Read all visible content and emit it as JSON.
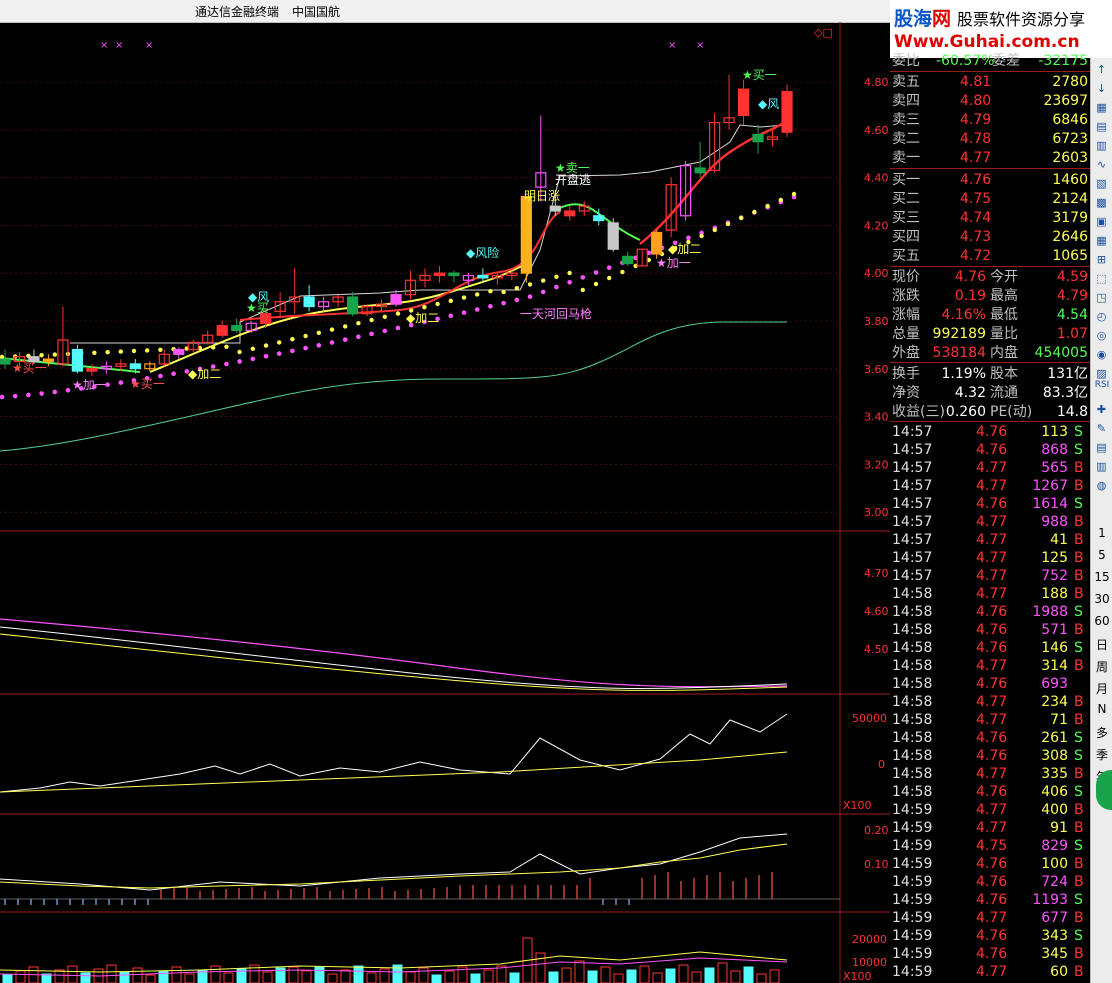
{
  "window": {
    "app_title": "通达信金融终端",
    "stock_name": "中国国航"
  },
  "branding": {
    "logo_name_a": "股海",
    "logo_name_b": "网",
    "logo_slogan": "股票软件资源分享",
    "logo_url": "Www.Guhai.com.cn"
  },
  "price_axis": [
    "4.80",
    "4.60",
    "4.40",
    "4.20",
    "4.00",
    "3.80",
    "3.60",
    "3.40",
    "3.20",
    "3.00"
  ],
  "ma_axis": [
    "4.70",
    "4.60",
    "4.50"
  ],
  "vol_axis": [
    "50000",
    "0"
  ],
  "vol_unit": "X100",
  "osc_axis": [
    "0.20",
    "0.10"
  ],
  "amount_axis": [
    "20000",
    "10000"
  ],
  "amount_unit": "X100",
  "chart_labels": {
    "risk1": "◆风险",
    "risk2": "◆风",
    "buy1": "★买一",
    "buy1b": "★买一",
    "add1a": "★加一",
    "add1b": "★加一",
    "add2a": "◆加二",
    "add2b": "◆加二",
    "add2c": "◆加二",
    "sell1": "★卖一",
    "open_escape": "开盘逃",
    "tomorrow_up": "明日涨",
    "bull": "一天河回马枪",
    "buy_top": "★买一",
    "buy_mid": "★买",
    "risk_mid": "◆风"
  },
  "chart_data": {
    "type": "candlestick",
    "title": "",
    "y_range": [
      2.95,
      4.85
    ],
    "candles": [
      {
        "o": 3.64,
        "h": 3.68,
        "l": 3.6,
        "c": 3.62
      },
      {
        "o": 3.63,
        "h": 3.67,
        "l": 3.61,
        "c": 3.65
      },
      {
        "o": 3.65,
        "h": 3.68,
        "l": 3.62,
        "c": 3.63
      },
      {
        "o": 3.63,
        "h": 3.66,
        "l": 3.61,
        "c": 3.64
      },
      {
        "o": 3.62,
        "h": 3.86,
        "l": 3.61,
        "c": 3.72
      },
      {
        "o": 3.68,
        "h": 3.7,
        "l": 3.58,
        "c": 3.59
      },
      {
        "o": 3.59,
        "h": 3.62,
        "l": 3.57,
        "c": 3.6
      },
      {
        "o": 3.6,
        "h": 3.63,
        "l": 3.58,
        "c": 3.61
      },
      {
        "o": 3.61,
        "h": 3.64,
        "l": 3.59,
        "c": 3.62
      },
      {
        "o": 3.62,
        "h": 3.64,
        "l": 3.58,
        "c": 3.6
      },
      {
        "o": 3.6,
        "h": 3.63,
        "l": 3.59,
        "c": 3.62
      },
      {
        "o": 3.62,
        "h": 3.68,
        "l": 3.61,
        "c": 3.66
      },
      {
        "o": 3.66,
        "h": 3.69,
        "l": 3.64,
        "c": 3.68
      },
      {
        "o": 3.68,
        "h": 3.72,
        "l": 3.67,
        "c": 3.71
      },
      {
        "o": 3.71,
        "h": 3.76,
        "l": 3.7,
        "c": 3.74
      },
      {
        "o": 3.74,
        "h": 3.8,
        "l": 3.73,
        "c": 3.78
      },
      {
        "o": 3.78,
        "h": 3.81,
        "l": 3.75,
        "c": 3.76
      },
      {
        "o": 3.76,
        "h": 3.8,
        "l": 3.75,
        "c": 3.79
      },
      {
        "o": 3.79,
        "h": 3.85,
        "l": 3.77,
        "c": 3.83
      },
      {
        "o": 3.84,
        "h": 3.92,
        "l": 3.82,
        "c": 3.88
      },
      {
        "o": 3.88,
        "h": 4.02,
        "l": 3.83,
        "c": 3.9
      },
      {
        "o": 3.9,
        "h": 3.95,
        "l": 3.84,
        "c": 3.86
      },
      {
        "o": 3.86,
        "h": 3.9,
        "l": 3.84,
        "c": 3.88
      },
      {
        "o": 3.88,
        "h": 3.91,
        "l": 3.86,
        "c": 3.9
      },
      {
        "o": 3.9,
        "h": 3.92,
        "l": 3.82,
        "c": 3.83
      },
      {
        "o": 3.83,
        "h": 3.87,
        "l": 3.82,
        "c": 3.86
      },
      {
        "o": 3.86,
        "h": 3.89,
        "l": 3.84,
        "c": 3.87
      },
      {
        "o": 3.87,
        "h": 3.93,
        "l": 3.86,
        "c": 3.91
      },
      {
        "o": 3.91,
        "h": 4.01,
        "l": 3.89,
        "c": 3.97
      },
      {
        "o": 3.97,
        "h": 4.02,
        "l": 3.94,
        "c": 3.99
      },
      {
        "o": 3.99,
        "h": 4.03,
        "l": 3.96,
        "c": 4.0
      },
      {
        "o": 4.0,
        "h": 4.01,
        "l": 3.96,
        "c": 3.99
      },
      {
        "o": 3.97,
        "h": 4.0,
        "l": 3.95,
        "c": 3.99
      },
      {
        "o": 3.99,
        "h": 4.02,
        "l": 3.96,
        "c": 3.98
      },
      {
        "o": 3.98,
        "h": 4.0,
        "l": 3.95,
        "c": 3.99
      },
      {
        "o": 3.99,
        "h": 4.01,
        "l": 3.97,
        "c": 4.0
      },
      {
        "o": 4.0,
        "h": 4.32,
        "l": 3.96,
        "c": 4.32
      },
      {
        "o": 4.36,
        "h": 4.66,
        "l": 4.3,
        "c": 4.42
      },
      {
        "o": 4.28,
        "h": 4.31,
        "l": 4.24,
        "c": 4.26
      },
      {
        "o": 4.24,
        "h": 4.28,
        "l": 4.22,
        "c": 4.26
      },
      {
        "o": 4.26,
        "h": 4.3,
        "l": 4.24,
        "c": 4.28
      },
      {
        "o": 4.24,
        "h": 4.27,
        "l": 4.2,
        "c": 4.22
      },
      {
        "o": 4.21,
        "h": 4.23,
        "l": 4.09,
        "c": 4.1
      },
      {
        "o": 4.07,
        "h": 4.09,
        "l": 4.03,
        "c": 4.04
      },
      {
        "o": 4.03,
        "h": 4.1,
        "l": 4.03,
        "c": 4.1
      },
      {
        "o": 4.08,
        "h": 4.18,
        "l": 4.06,
        "c": 4.17
      },
      {
        "o": 4.18,
        "h": 4.4,
        "l": 4.15,
        "c": 4.37
      },
      {
        "o": 4.24,
        "h": 4.47,
        "l": 4.22,
        "c": 4.45
      },
      {
        "o": 4.44,
        "h": 4.55,
        "l": 4.4,
        "c": 4.42
      },
      {
        "o": 4.43,
        "h": 4.67,
        "l": 4.42,
        "c": 4.63
      },
      {
        "o": 4.63,
        "h": 4.83,
        "l": 4.6,
        "c": 4.65
      },
      {
        "o": 4.66,
        "h": 4.81,
        "l": 4.62,
        "c": 4.77
      },
      {
        "o": 4.58,
        "h": 4.62,
        "l": 4.5,
        "c": 4.55
      },
      {
        "o": 4.56,
        "h": 4.6,
        "l": 4.53,
        "c": 4.57
      },
      {
        "o": 4.59,
        "h": 4.79,
        "l": 4.57,
        "c": 4.76
      }
    ]
  },
  "quote": {
    "top": {
      "label": "委比",
      "value": "-60.57%",
      "label2": "委差",
      "value2": "-32175"
    },
    "asks": [
      {
        "label": "卖五",
        "price": "4.81",
        "vol": "2780"
      },
      {
        "label": "卖四",
        "price": "4.80",
        "vol": "23697"
      },
      {
        "label": "卖三",
        "price": "4.79",
        "vol": "6846"
      },
      {
        "label": "卖二",
        "price": "4.78",
        "vol": "6723"
      },
      {
        "label": "卖一",
        "price": "4.77",
        "vol": "2603"
      }
    ],
    "bids": [
      {
        "label": "买一",
        "price": "4.76",
        "vol": "1460"
      },
      {
        "label": "买二",
        "price": "4.75",
        "vol": "2124"
      },
      {
        "label": "买三",
        "price": "4.74",
        "vol": "3179"
      },
      {
        "label": "买四",
        "price": "4.73",
        "vol": "2646"
      },
      {
        "label": "买五",
        "price": "4.72",
        "vol": "1065"
      }
    ],
    "stats": [
      {
        "l1": "现价",
        "v1": "4.76",
        "l2": "今开",
        "v2": "4.59"
      },
      {
        "l1": "涨跌",
        "v1": "0.19",
        "l2": "最高",
        "v2": "4.79"
      },
      {
        "l1": "涨幅",
        "v1": "4.16%",
        "l2": "最低",
        "v2": "4.54"
      },
      {
        "l1": "总量",
        "v1": "992189",
        "l2": "量比",
        "v2": "1.07"
      },
      {
        "l1": "外盘",
        "v1": "538184",
        "l2": "内盘",
        "v2": "454005"
      }
    ],
    "info": [
      {
        "l1": "换手",
        "v1": "1.19%",
        "l2": "股本",
        "v2": "131亿"
      },
      {
        "l1": "净资",
        "v1": "4.32",
        "l2": "流通",
        "v2": "83.3亿"
      },
      {
        "l1": "收益(三)",
        "v1": "0.260",
        "l2": "PE(动)",
        "v2": "14.8"
      }
    ]
  },
  "ticks": [
    {
      "t": "14:57",
      "p": "4.76",
      "v": "113",
      "s": "S"
    },
    {
      "t": "14:57",
      "p": "4.76",
      "v": "868",
      "s": "S"
    },
    {
      "t": "14:57",
      "p": "4.77",
      "v": "565",
      "s": "B"
    },
    {
      "t": "14:57",
      "p": "4.77",
      "v": "1267",
      "s": "B"
    },
    {
      "t": "14:57",
      "p": "4.76",
      "v": "1614",
      "s": "S"
    },
    {
      "t": "14:57",
      "p": "4.77",
      "v": "988",
      "s": "B"
    },
    {
      "t": "14:57",
      "p": "4.77",
      "v": "41",
      "s": "B"
    },
    {
      "t": "14:57",
      "p": "4.77",
      "v": "125",
      "s": "B"
    },
    {
      "t": "14:57",
      "p": "4.77",
      "v": "752",
      "s": "B"
    },
    {
      "t": "14:58",
      "p": "4.77",
      "v": "188",
      "s": "B"
    },
    {
      "t": "14:58",
      "p": "4.76",
      "v": "1988",
      "s": "S"
    },
    {
      "t": "14:58",
      "p": "4.76",
      "v": "571",
      "s": "B"
    },
    {
      "t": "14:58",
      "p": "4.76",
      "v": "146",
      "s": "S"
    },
    {
      "t": "14:58",
      "p": "4.77",
      "v": "314",
      "s": "B"
    },
    {
      "t": "14:58",
      "p": "4.76",
      "v": "693",
      "s": ""
    },
    {
      "t": "14:58",
      "p": "4.77",
      "v": "234",
      "s": "B"
    },
    {
      "t": "14:58",
      "p": "4.77",
      "v": "71",
      "s": "B"
    },
    {
      "t": "14:58",
      "p": "4.76",
      "v": "261",
      "s": "S"
    },
    {
      "t": "14:58",
      "p": "4.76",
      "v": "308",
      "s": "S"
    },
    {
      "t": "14:58",
      "p": "4.77",
      "v": "335",
      "s": "B"
    },
    {
      "t": "14:58",
      "p": "4.76",
      "v": "406",
      "s": "S"
    },
    {
      "t": "14:59",
      "p": "4.77",
      "v": "400",
      "s": "B"
    },
    {
      "t": "14:59",
      "p": "4.77",
      "v": "91",
      "s": "B"
    },
    {
      "t": "14:59",
      "p": "4.75",
      "v": "829",
      "s": "S"
    },
    {
      "t": "14:59",
      "p": "4.76",
      "v": "100",
      "s": "B"
    },
    {
      "t": "14:59",
      "p": "4.76",
      "v": "724",
      "s": "B"
    },
    {
      "t": "14:59",
      "p": "4.76",
      "v": "1193",
      "s": "S"
    },
    {
      "t": "14:59",
      "p": "4.77",
      "v": "677",
      "s": "B"
    },
    {
      "t": "14:59",
      "p": "4.76",
      "v": "343",
      "s": "S"
    },
    {
      "t": "14:59",
      "p": "4.76",
      "v": "345",
      "s": "B"
    },
    {
      "t": "14:59",
      "p": "4.77",
      "v": "60",
      "s": "B"
    }
  ],
  "toolbar_text": [
    "1",
    "5",
    "15",
    "30",
    "60",
    "日",
    "周",
    "月",
    "N",
    "多",
    "季",
    "年"
  ],
  "toolbar_icons": [
    "RSI"
  ],
  "colors": {
    "up": "#ff3232",
    "down": "#54fcfc",
    "yellow": "#ffff54",
    "magenta": "#ff54ff",
    "green": "#54fc54",
    "grid": "#8b1a1a"
  }
}
